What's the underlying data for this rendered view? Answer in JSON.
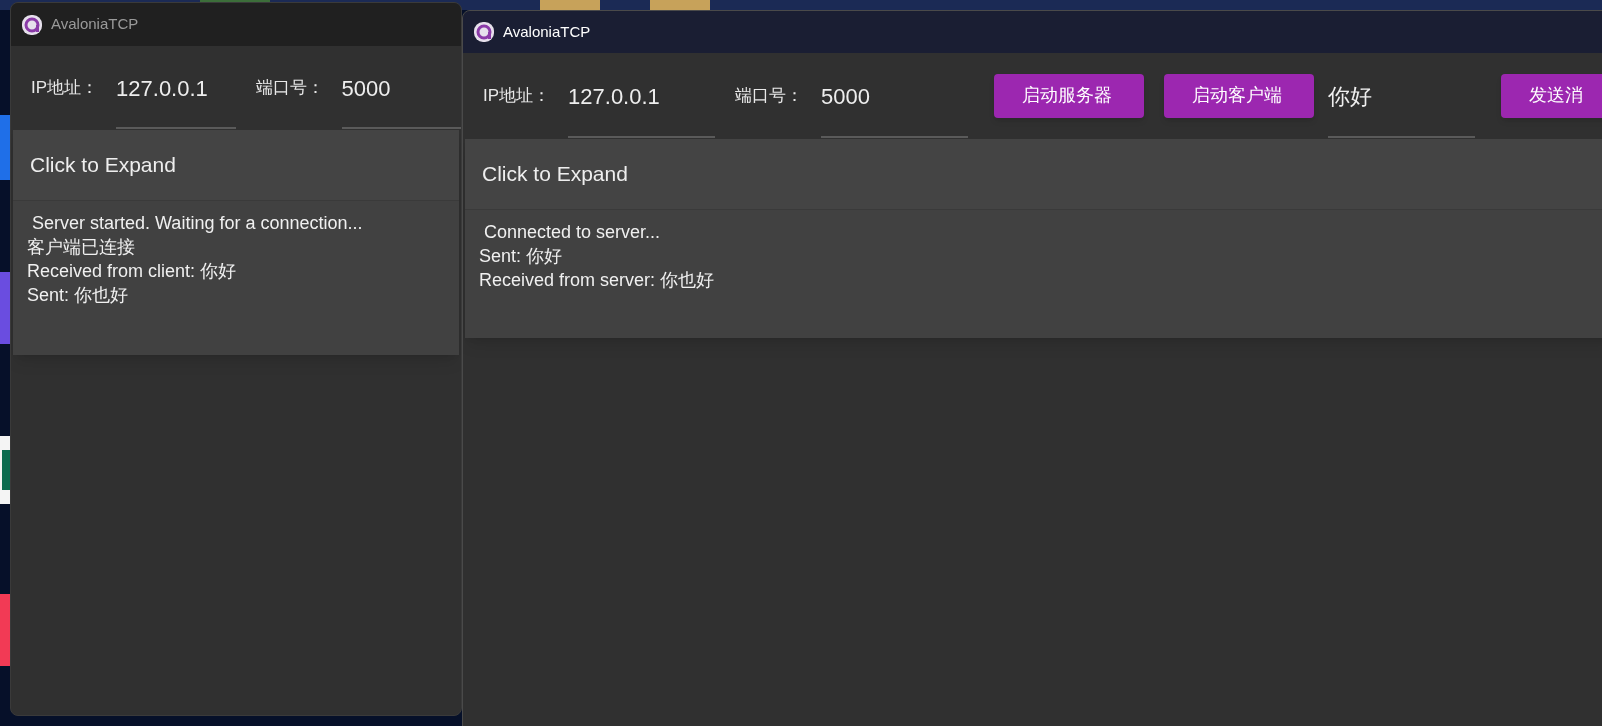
{
  "windows": [
    {
      "title": "AvaloniaTCP",
      "active": false,
      "toolbar": [
        {
          "kind": "label",
          "text": "IP地址："
        },
        {
          "kind": "field",
          "value": "127.0.0.1"
        },
        {
          "kind": "label",
          "text": "端口号："
        },
        {
          "kind": "field",
          "value": "5000"
        }
      ],
      "expander": {
        "header": "Click to Expand",
        "expanded": true
      },
      "log": [
        " Server started. Waiting for a connection...",
        "客户端已连接",
        "Received from client: 你好",
        "Sent: 你也好"
      ]
    },
    {
      "title": "AvaloniaTCP",
      "active": true,
      "toolbar": [
        {
          "kind": "label",
          "text": "IP地址："
        },
        {
          "kind": "field",
          "value": "127.0.0.1"
        },
        {
          "kind": "label",
          "text": "端口号："
        },
        {
          "kind": "field",
          "value": "5000"
        },
        {
          "kind": "button",
          "text": "启动服务器"
        },
        {
          "kind": "button",
          "text": "启动客户端"
        },
        {
          "kind": "field",
          "value": "你好"
        },
        {
          "kind": "button",
          "text": "发送消"
        }
      ],
      "expander": {
        "header": "Click to Expand",
        "expanded": true
      },
      "log": [
        " Connected to server...",
        "Sent: 你好",
        "Received from server: 你也好"
      ]
    }
  ]
}
